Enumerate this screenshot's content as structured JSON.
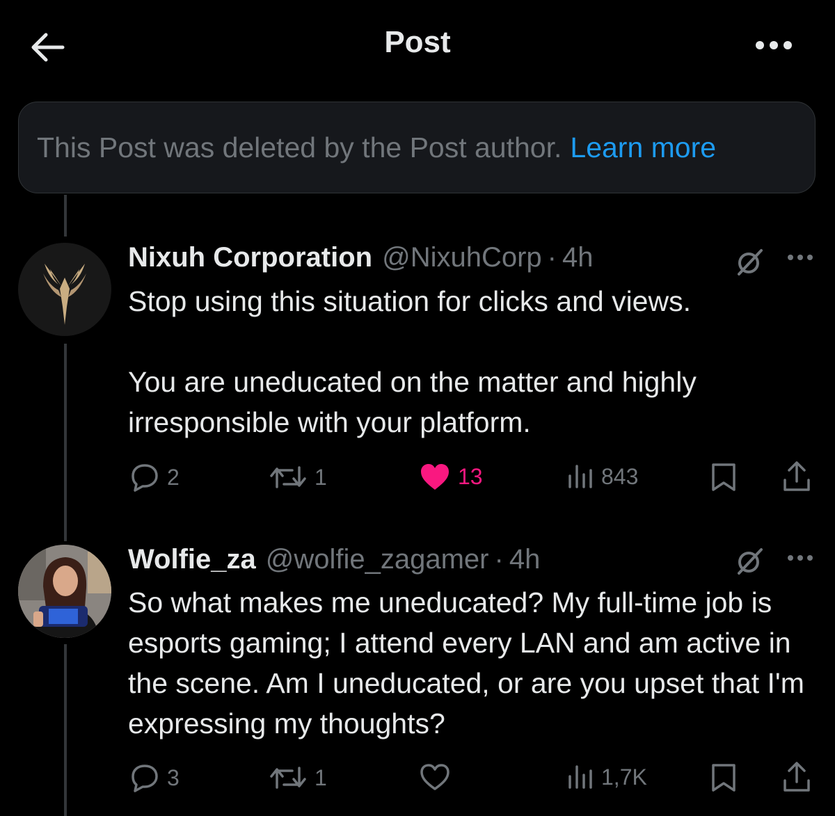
{
  "header": {
    "title": "Post"
  },
  "notice": {
    "text": "This Post was deleted by the Post author.",
    "link": "Learn more"
  },
  "posts": [
    {
      "display_name": "Nixuh Corporation",
      "handle": "@NixuhCorp",
      "separator": "·",
      "time": "4h",
      "paragraphs": [
        "Stop using this situation for clicks and views.",
        "You are uneducated on the matter and highly irresponsible with your platform."
      ],
      "replies": "2",
      "reposts": "1",
      "likes": "13",
      "liked": true,
      "views": "843"
    },
    {
      "display_name": "Wolfie_za",
      "handle": "@wolfie_zagamer",
      "separator": "·",
      "time": "4h",
      "paragraphs": [
        "So what makes me uneducated? My full-time job is esports gaming; I attend every LAN and am active in the scene. Am I uneducated, or are you upset that I'm expressing my thoughts?"
      ],
      "replies": "3",
      "reposts": "1",
      "likes": "",
      "liked": false,
      "views": "1,7K"
    }
  ],
  "icons": {
    "back": "arrow-left-icon",
    "more": "more-horizontal-icon",
    "grok": "grok-slash-icon",
    "reply": "speech-bubble-icon",
    "repost": "repost-arrows-icon",
    "like": "heart-icon",
    "views": "bar-chart-icon",
    "bookmark": "bookmark-icon",
    "share": "share-upload-icon"
  },
  "colors": {
    "background": "#000000",
    "text": "#e7e9ea",
    "muted": "#71767b",
    "link": "#1d9bf0",
    "like": "#f91880",
    "notice_bg": "#16181c"
  }
}
